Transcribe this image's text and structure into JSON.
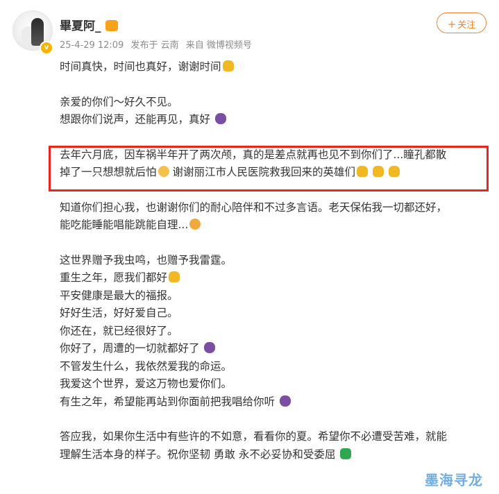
{
  "post": {
    "username": "畢夏阿_",
    "date": "25-4-29 12:09",
    "location": "发布于 云南",
    "source": "来自 微博视频号",
    "follow_label": "关注",
    "follow_plus": "+"
  },
  "content": {
    "p1": [
      "时间真快，时间也真好，谢谢时间"
    ],
    "p2": [
      "亲爱的你们～好久不见。",
      "想跟你们说声，还能再见，真好"
    ],
    "p3": [
      "去年六月底，因车祸半年开了两次颅，真的是差点就再也见不到你们了...瞳孔都散",
      "掉了一只想想就后怕",
      "谢谢丽江市人民医院救我回来的英雄们"
    ],
    "p4": [
      "知道你们担心我，也谢谢你们的耐心陪伴和不过多言语。老天保佑我一切都还好，",
      "能吃能睡能唱能跳能自理..."
    ],
    "p5": [
      "这世界赠予我虫鸣，也赠予我雷霆。",
      "重生之年，愿我们都好",
      "平安健康是最大的福报。",
      "好好生活，好好爱自己。",
      "你还在，就已经很好了。",
      "你好了，周遭的一切就都好了",
      "不管发生什么，我依然爱我的命运。",
      "我爱这个世界，爱这万物也爱你们。",
      "有生之年，希望能再站到你面前把我唱给你听"
    ],
    "p6": [
      "答应我，如果你生活中有些许的不如意，看看你的夏。希望你不必遭受苦难，就能",
      "理解生活本身的样子。祝你坚韧 勇敢 永不必妥协和受委屈"
    ]
  },
  "emojis": {
    "pray": "praying-hands-icon",
    "flower": "purple-flower-icon",
    "fear": "fearful-face-icon",
    "cry": "crying-face-icon",
    "clover": "four-leaf-clover-icon"
  },
  "colors": {
    "accent": "#f5822f",
    "highlight_border": "#e8261f",
    "meta_text": "#8a8a8a",
    "body_text": "#333333"
  },
  "watermark": "墨海寻龙"
}
